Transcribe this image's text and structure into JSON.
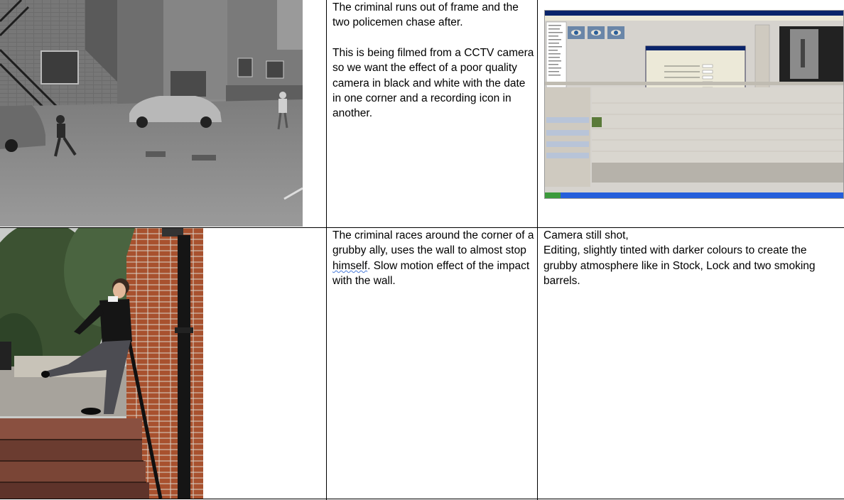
{
  "rows": [
    {
      "description": [
        "The criminal runs out of frame and the two policemen chase after.",
        "This is being filmed from a CCTV camera so we want the effect of a poor quality camera in black and white with the date in one corner and a recording icon in another."
      ],
      "notes": []
    },
    {
      "description_parts": [
        "The criminal races around the corner of a grubby ally, uses the wall to almost stop ",
        "himself",
        ". Slow motion effect of the impact with the wall."
      ],
      "notes": [
        "Camera still shot,",
        "Editing, slightly tinted with darker colours to create the grubby atmosphere like in Stock, Lock and two smoking barrels."
      ]
    }
  ]
}
